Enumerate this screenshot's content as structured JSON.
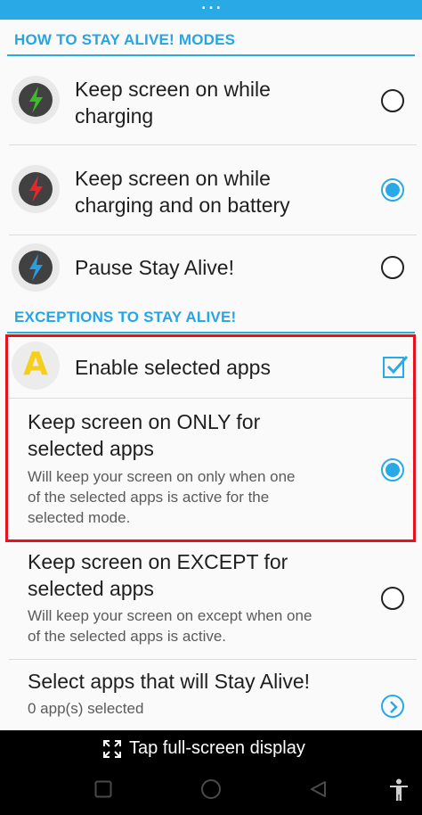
{
  "sections": {
    "modes_header": "HOW TO STAY ALIVE! MODES",
    "exceptions_header": "EXCEPTIONS TO STAY ALIVE!"
  },
  "modes": [
    {
      "title_line1": "Keep screen on while",
      "title_line2": "charging",
      "icon": "green-lightning-icon",
      "selected": false
    },
    {
      "title_line1": "Keep screen on while",
      "title_line2": "charging and on battery",
      "icon": "red-lightning-icon",
      "selected": true
    },
    {
      "title_line1": "Pause Stay Alive!",
      "icon": "blue-lightning-icon",
      "selected": false
    }
  ],
  "exceptions": {
    "enable_apps": {
      "title": "Enable selected apps",
      "icon": "app-letter-icon",
      "icon_letter": "A",
      "checked": true
    },
    "only_for": {
      "title_line1": "Keep screen on ONLY for",
      "title_line2": "selected apps",
      "summary_line1": "Will keep your screen on only when one",
      "summary_line2": "of the selected apps is active for the",
      "summary_line3": "selected mode.",
      "selected": true
    },
    "except_for": {
      "title_line1": "Keep screen on EXCEPT for",
      "title_line2": "selected apps",
      "summary_line1": "Will keep your screen on except when one",
      "summary_line2": "of the selected apps is active.",
      "selected": false
    },
    "select_apps": {
      "title": "Select apps that will Stay Alive!",
      "summary": "0 app(s) selected"
    }
  },
  "fullscreen_bar": {
    "label": "Tap full-screen display"
  },
  "colors": {
    "accent": "#29a9e6",
    "highlight": "#e8121e",
    "green_bolt": "#3dbb2a",
    "red_bolt": "#e8262c",
    "blue_bolt": "#2c9be0",
    "app_letter": "#f5cf1b"
  }
}
